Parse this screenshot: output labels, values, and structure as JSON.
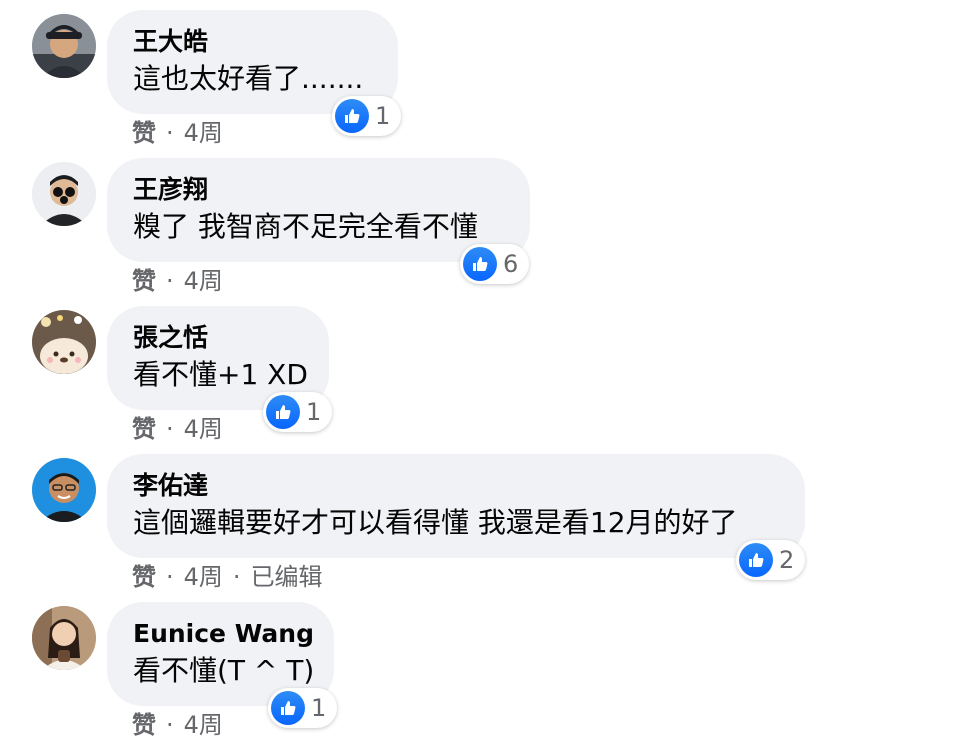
{
  "comments": [
    {
      "author": "王大皓",
      "text": "這也太好看了.......",
      "reaction_count": "1",
      "like_label": "赞",
      "time": "4周",
      "edited": ""
    },
    {
      "author": "王彦翔",
      "text": "糗了 我智商不足完全看不懂",
      "reaction_count": "6",
      "like_label": "赞",
      "time": "4周",
      "edited": ""
    },
    {
      "author": "張之恬",
      "text": "看不懂+1 XD",
      "reaction_count": "1",
      "like_label": "赞",
      "time": "4周",
      "edited": ""
    },
    {
      "author": "李佑達",
      "text": "這個邏輯要好才可以看得懂 我還是看12月的好了",
      "reaction_count": "2",
      "like_label": "赞",
      "time": "4周",
      "edited": "已编辑"
    },
    {
      "author": "Eunice Wang",
      "text": "看不懂(T ^ T)",
      "reaction_count": "1",
      "like_label": "赞",
      "time": "4周",
      "edited": ""
    }
  ],
  "icons": {
    "reaction": "like-thumbs-up-icon",
    "avatar": "user-avatar"
  },
  "colors": {
    "bubble": "#f0f2f5",
    "like_blue": "#0866ff",
    "meta_gray": "#65676b"
  }
}
